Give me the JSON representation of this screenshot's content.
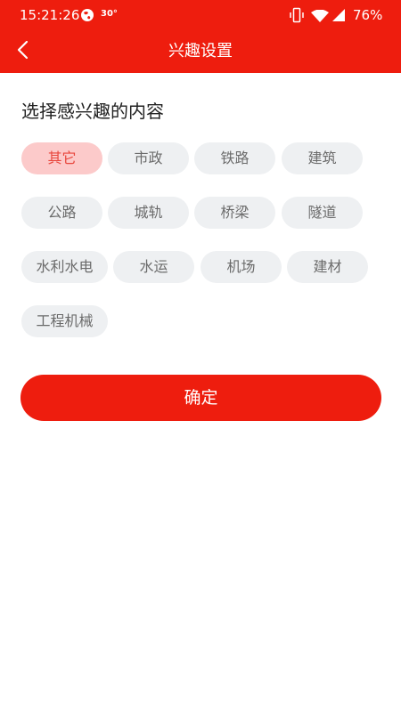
{
  "status_bar": {
    "time": "15:21:26",
    "temperature": "30°",
    "battery": "76%"
  },
  "nav": {
    "title": "兴趣设置"
  },
  "content": {
    "heading": "选择感兴趣的内容",
    "chips": [
      {
        "label": "其它",
        "selected": true
      },
      {
        "label": "市政",
        "selected": false
      },
      {
        "label": "铁路",
        "selected": false
      },
      {
        "label": "建筑",
        "selected": false
      },
      {
        "label": "公路",
        "selected": false
      },
      {
        "label": "城轨",
        "selected": false
      },
      {
        "label": "桥梁",
        "selected": false
      },
      {
        "label": "隧道",
        "selected": false
      },
      {
        "label": "水利水电",
        "selected": false
      },
      {
        "label": "水运",
        "selected": false
      },
      {
        "label": "机场",
        "selected": false
      },
      {
        "label": "建材",
        "selected": false
      },
      {
        "label": "工程机械",
        "selected": false
      }
    ]
  },
  "confirm_label": "确定",
  "colors": {
    "brand_red": "#ee1d0e",
    "chip_bg": "#eef0f2",
    "chip_selected_bg": "#fccaca",
    "chip_selected_text": "#e8473d"
  }
}
